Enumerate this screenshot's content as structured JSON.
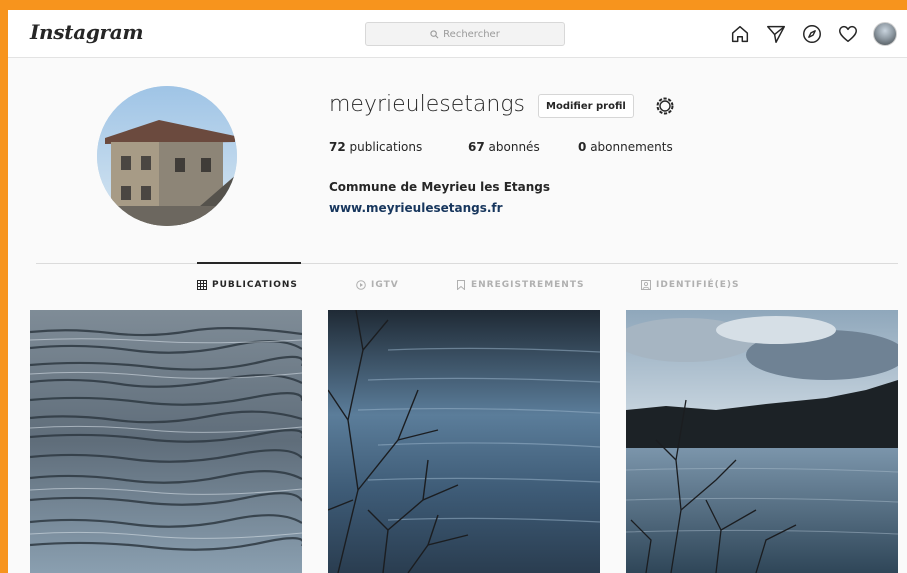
{
  "header": {
    "logo": "Instagram",
    "search_placeholder": "Rechercher",
    "icons": [
      "home-icon",
      "direct-icon",
      "explore-icon",
      "activity-icon",
      "profile-avatar"
    ]
  },
  "profile": {
    "username": "meyrieulesetangs",
    "edit_button": "Modifier profil",
    "stats": [
      {
        "count": "72",
        "label": "publications"
      },
      {
        "count": "67",
        "label": "abonnés"
      },
      {
        "count": "0",
        "label": "abonnements"
      }
    ],
    "full_name": "Commune de Meyrieu les Etangs",
    "website": "www.meyrieulesetangs.fr"
  },
  "tabs": [
    {
      "label": "PUBLICATIONS",
      "active": true
    },
    {
      "label": "IGTV",
      "active": false
    },
    {
      "label": "ENREGISTREMENTS",
      "active": false
    },
    {
      "label": "IDENTIFIÉ(E)S",
      "active": false
    }
  ],
  "posts": [
    "water-ripples-photo",
    "lake-branches-photo",
    "lake-landscape-photo"
  ],
  "colors": {
    "frame": "#f7941d",
    "text": "#262626",
    "link": "#17365d"
  }
}
